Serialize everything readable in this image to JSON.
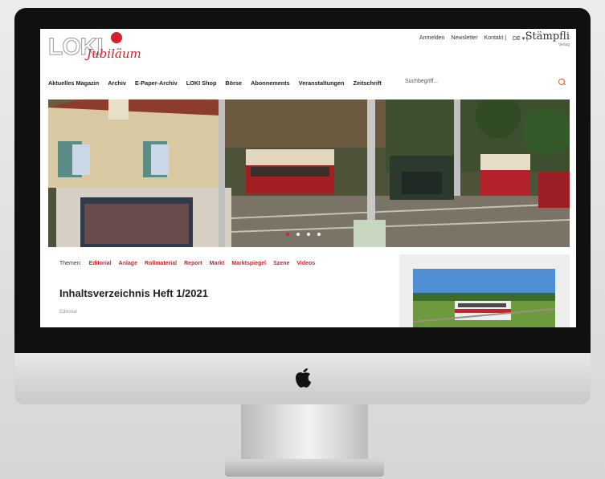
{
  "site": {
    "logo_text": "LOKI",
    "logo_sub": "Jubiläum",
    "top_links": [
      "Anmelden",
      "Newsletter",
      "Kontakt |",
      "DE ▾ |"
    ],
    "brand": "Stämpfli",
    "brand_sub": "Verlag"
  },
  "nav": [
    "Aktuelles Magazin",
    "Archiv",
    "E-Paper-Archiv",
    "LOKI Shop",
    "Börse",
    "Abonnements",
    "Veranstaltungen",
    "Zeitschrift"
  ],
  "search": {
    "placeholder": "Suchbegriff..."
  },
  "slider": {
    "count": 4,
    "active": 0
  },
  "themes": {
    "label": "Themen:",
    "items": [
      "Editorial",
      "Anlage",
      "Rollmaterial",
      "Report",
      "Markt",
      "Marktspiegel",
      "Szene",
      "Videos"
    ]
  },
  "article": {
    "title": "Inhaltsverzeichnis Heft 1/2021",
    "category": "Editorial"
  },
  "colors": {
    "accent": "#d3222a",
    "search_icon": "#e05a2a"
  }
}
